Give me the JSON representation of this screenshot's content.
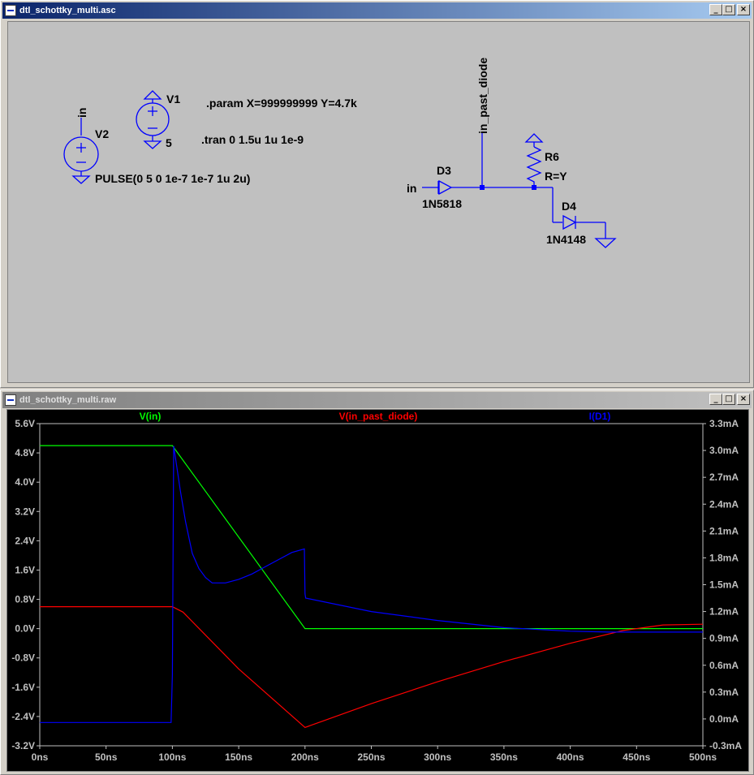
{
  "schematic_window": {
    "title": "dtl_schottky_multi.asc",
    "buttons": [
      "_",
      "□",
      "×"
    ],
    "components": {
      "v1": {
        "name": "V1",
        "value": "5"
      },
      "v2": {
        "name": "V2",
        "value": "PULSE(0 5 0 1e-7 1e-7 1u 2u)",
        "net": "in"
      },
      "d3": {
        "name": "D3",
        "model": "1N5818"
      },
      "d4": {
        "name": "D4",
        "model": "1N4148"
      },
      "r6": {
        "name": "R6",
        "value": "R=Y"
      }
    },
    "directives": {
      "param": ".param X=999999999 Y=4.7k",
      "tran": ".tran 0 1.5u 1u 1e-9"
    },
    "net_labels": {
      "in": "in",
      "in_past_diode": "in_past_diode"
    }
  },
  "plot_window": {
    "title": "dtl_schottky_multi.raw",
    "buttons": [
      "_",
      "□",
      "×"
    ],
    "background": "#000000",
    "axis_color": "#c0c0c0"
  },
  "chart_data": {
    "type": "line",
    "title": "",
    "xlabel": "",
    "x_ticks": [
      "0ns",
      "50ns",
      "100ns",
      "150ns",
      "200ns",
      "250ns",
      "300ns",
      "350ns",
      "400ns",
      "450ns",
      "500ns"
    ],
    "xlim": [
      0,
      500
    ],
    "left_axis": {
      "ticks": [
        "5.6V",
        "4.8V",
        "4.0V",
        "3.2V",
        "2.4V",
        "1.6V",
        "0.8V",
        "0.0V",
        "-0.8V",
        "-1.6V",
        "-2.4V",
        "-3.2V"
      ],
      "ylim": [
        -3.2,
        5.6
      ]
    },
    "right_axis": {
      "ticks": [
        "3.3mA",
        "3.0mA",
        "2.7mA",
        "2.4mA",
        "2.1mA",
        "1.8mA",
        "1.5mA",
        "1.2mA",
        "0.9mA",
        "0.6mA",
        "0.3mA",
        "0.0mA",
        "-0.3mA"
      ],
      "ylim": [
        -0.3,
        3.3
      ]
    },
    "grid": false,
    "series": [
      {
        "name": "V(in)",
        "color": "#00ff00",
        "axis": "left",
        "x": [
          0,
          100,
          200,
          500
        ],
        "y": [
          5.0,
          5.0,
          0.0,
          0.0
        ]
      },
      {
        "name": "V(in_past_diode)",
        "color": "#ff0000",
        "axis": "left",
        "x": [
          0,
          100,
          108,
          150,
          200,
          250,
          300,
          350,
          400,
          440,
          470,
          500
        ],
        "y": [
          0.6,
          0.6,
          0.45,
          -1.1,
          -2.7,
          -2.05,
          -1.45,
          -0.9,
          -0.4,
          -0.05,
          0.1,
          0.12
        ]
      },
      {
        "name": "I(D1)",
        "color": "#0000ff",
        "axis": "right",
        "x": [
          0,
          99,
          100,
          101,
          103,
          106,
          110,
          115,
          120,
          125,
          130,
          140,
          150,
          160,
          170,
          180,
          190,
          199.5,
          200,
          200.5,
          250,
          300,
          350,
          400,
          430,
          460,
          500
        ],
        "y": [
          -0.04,
          -0.04,
          0.5,
          3.05,
          2.85,
          2.55,
          2.2,
          1.85,
          1.68,
          1.58,
          1.52,
          1.52,
          1.56,
          1.62,
          1.7,
          1.78,
          1.86,
          1.9,
          1.4,
          1.35,
          1.2,
          1.1,
          1.02,
          0.98,
          0.97,
          0.97,
          0.97
        ]
      }
    ]
  }
}
